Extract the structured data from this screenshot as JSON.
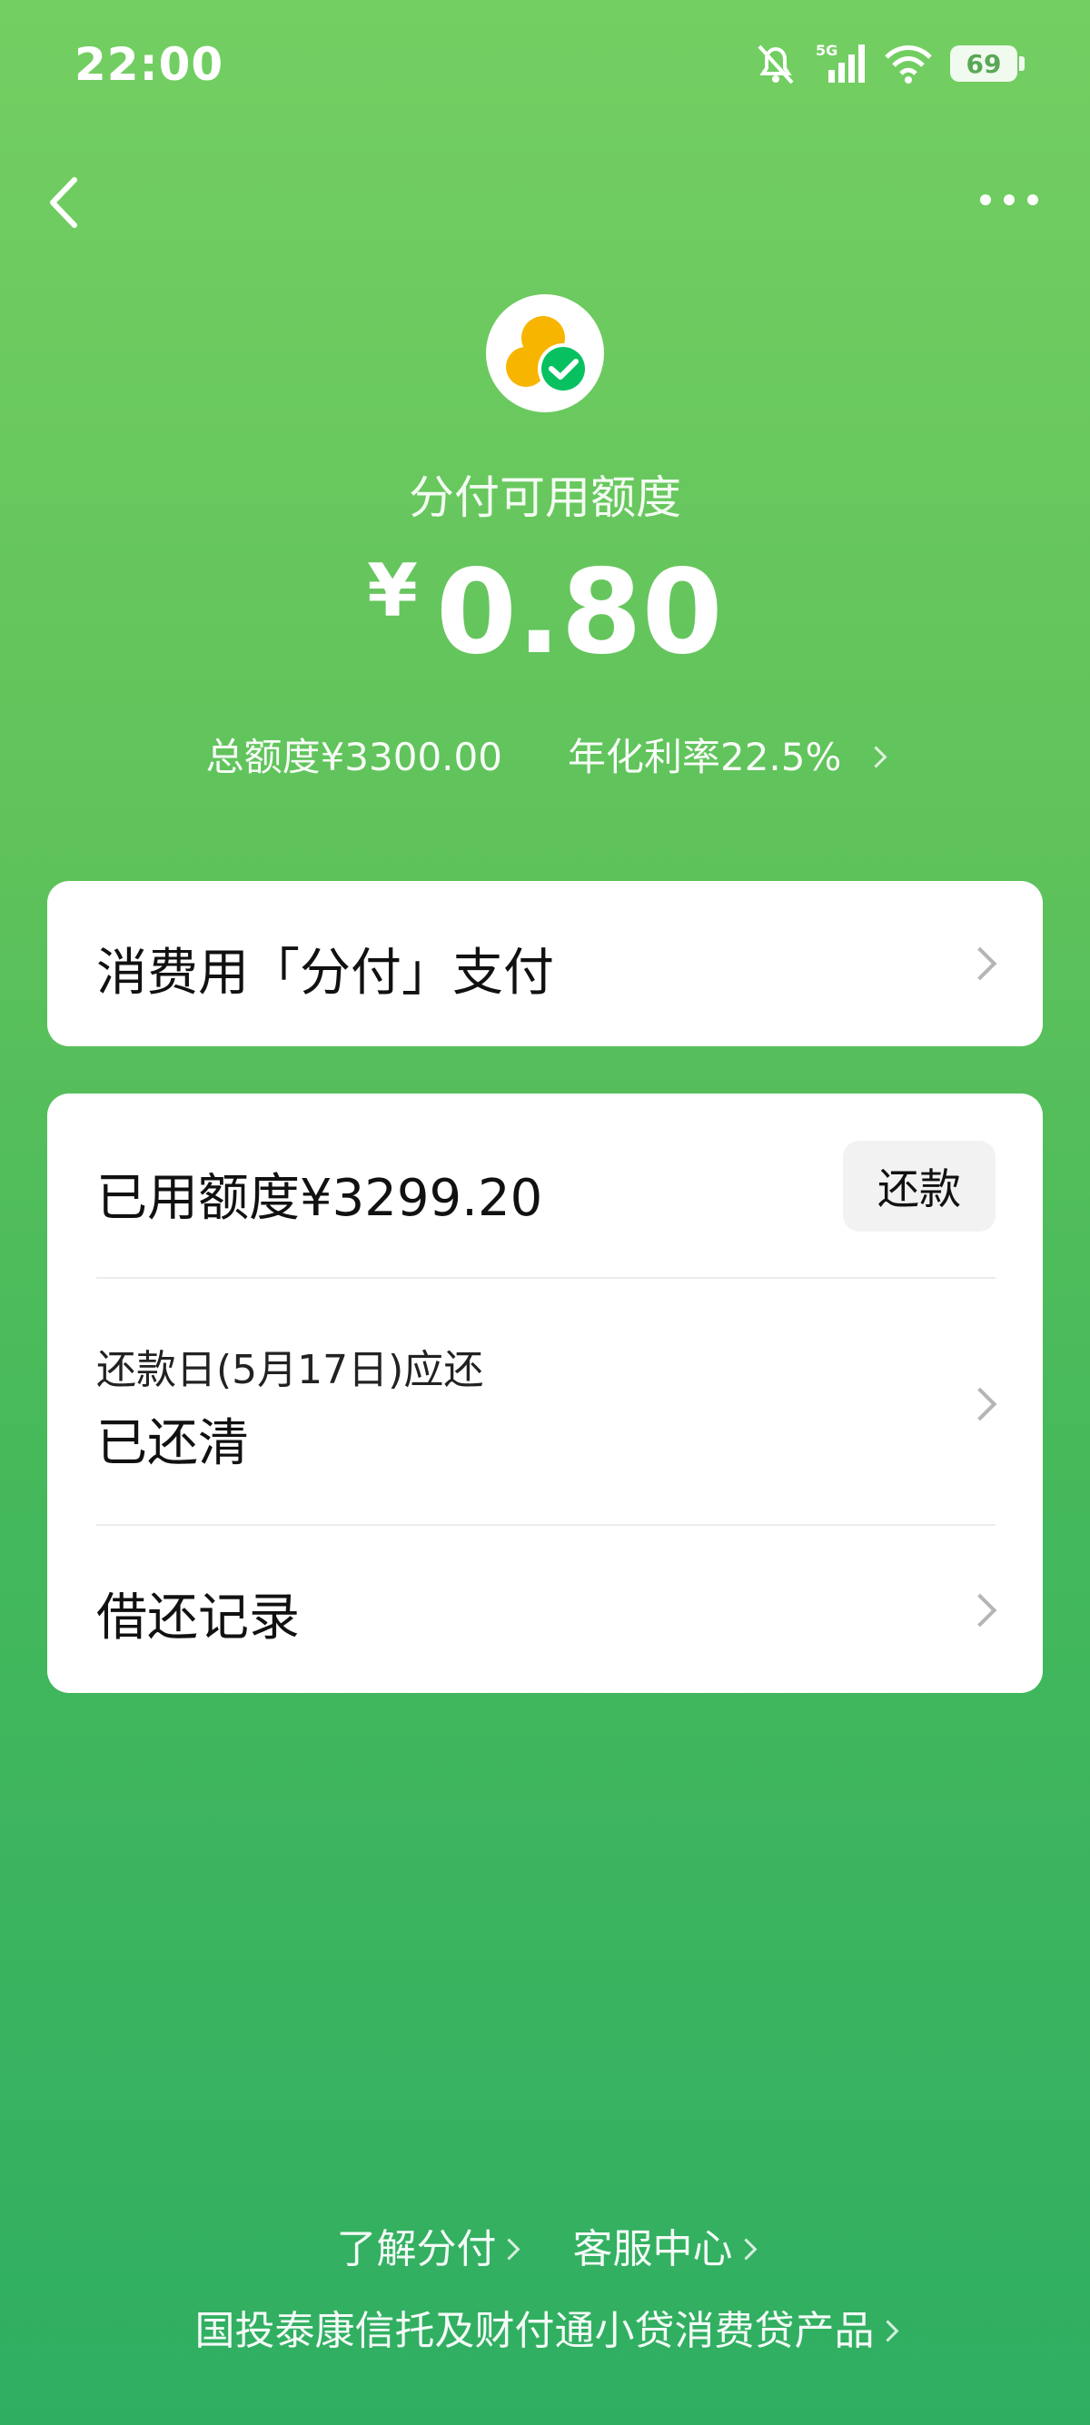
{
  "status": {
    "time": "22:00",
    "network": "5G",
    "battery": "69"
  },
  "header": {
    "title": "分付可用额度",
    "currency": "¥",
    "amount": "0.80",
    "total_limit": "总额度¥3300.00",
    "annual_rate": "年化利率22.5%"
  },
  "pay_card": {
    "label": "消费用「分付」支付"
  },
  "usage_card": {
    "used_label": "已用额度¥3299.20",
    "repay_button": "还款",
    "due_label": "还款日(5月17日)应还",
    "due_status": "已还清",
    "records_label": "借还记录"
  },
  "footer": {
    "learn_link": "了解分付",
    "service_link": "客服中心",
    "provider_note": "国投泰康信托及财付通小贷消费贷产品"
  },
  "colors": {
    "brand_green": "#07c160",
    "logo_yellow": "#f7b500"
  }
}
